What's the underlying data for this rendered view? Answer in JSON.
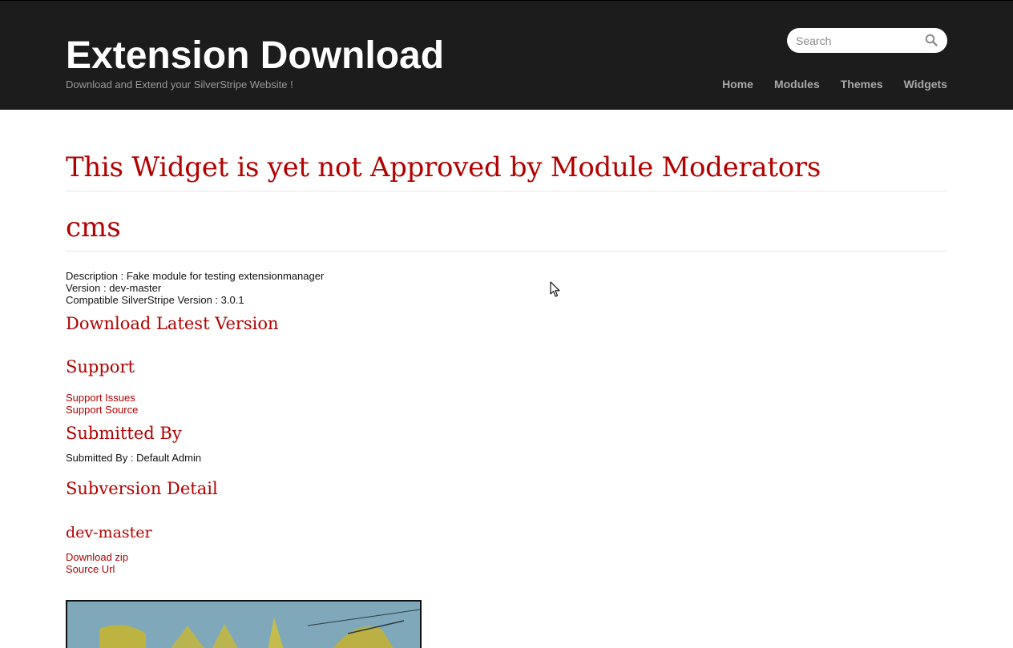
{
  "header": {
    "site_title": "Extension Download",
    "tagline": "Download and Extend your SilverStripe Website !",
    "search_placeholder": "Search",
    "nav": [
      "Home",
      "Modules",
      "Themes",
      "Widgets"
    ]
  },
  "main": {
    "notice_heading": "This Widget is yet not Approved by Module Moderators",
    "name": "cms",
    "description": "Description : Fake module for testing extensionmanager",
    "version": "Version : dev-master",
    "compatible": "Compatible SilverStripe Version : 3.0.1",
    "download_latest": "Download Latest Version",
    "support_heading": "Support",
    "support_issues": "Support Issues",
    "support_source": "Support Source",
    "submitted_heading": "Submitted By",
    "submitted_by": "Submitted By : Default Admin",
    "subversion_heading": "Subversion Detail",
    "subversion_name": "dev-master",
    "download_zip": "Download zip",
    "source_url": "Source Url"
  },
  "colors": {
    "header_bg": "#1c1c1c",
    "accent_red": "#b30000",
    "nav_text": "#a8a8a8"
  },
  "icons": [
    "search-icon",
    "mouse-cursor-icon"
  ]
}
